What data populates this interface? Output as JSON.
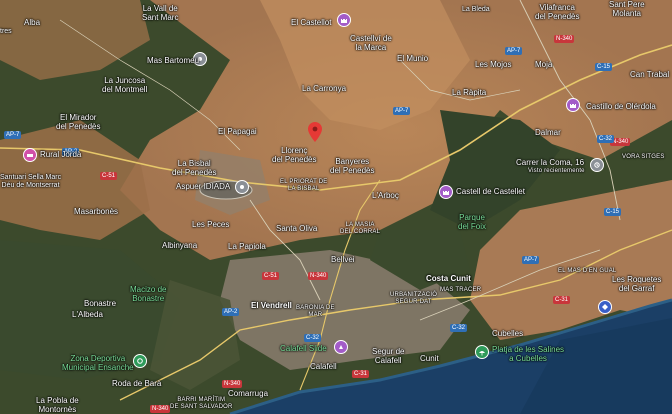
{
  "map": {
    "colors": {
      "water": "#1b3f66",
      "coast": "#2c5f86",
      "terrain": "#b8865a",
      "forest": "#34422a",
      "motorway": "#e7c86a",
      "selected_pin": "#e53935"
    },
    "places": {
      "alba": "Alba",
      "vall_sant_marc": "La Vall de\nSant Marc",
      "el_castellot": "El Castellot",
      "castellvi": "Castellví de\nla Marca",
      "la_bleda": "La Bleda",
      "vilafranca": "Vilafranca\ndel Penedès",
      "sant_pere_molanta": "Sant Pere\nMolanta",
      "mas_bartomeu": "Mas Bartomeu",
      "les_mojos": "Les Mojos",
      "el_munio": "El Munio",
      "moja": "Moja",
      "la_juncosa": "La Juncosa\ndel Montmell",
      "la_carronya": "La Carronya",
      "la_rapita": "La Ràpita",
      "can_trabal": "Can Trabal",
      "tres": "tres",
      "el_mirador": "El Mirador\ndel Penedès",
      "castillo_olerdola": "Castillo de Olérdola",
      "el_papagai": "El Papagai",
      "dalmar": "Dalmar",
      "rural_jorda": "Rural Jordà",
      "santuari": "Santuari Sella Marc\nDéu de Montserrat",
      "bisbal": "La Bisbal\ndel Penedès",
      "llorenc": "Llorenç\ndel Penedès",
      "banyeres": "Banyeres\ndel Penedès",
      "carrer_la_coma": "Carrer la Coma, 16",
      "carrer_sub": "Visto recientemente",
      "vora_sitges": "VORA SITGES",
      "masarbones": "Masarbonès",
      "aspuer_idiada": "Aspuer IDIADA",
      "el_priorat_bisbal": "EL PRIORAT DE\nLA BISBAL",
      "larboc": "L'Arboç",
      "castell_castellet": "Castell de Castellet",
      "parque_foix": "Parque\ndel Foix",
      "les_peces": "Les Peces",
      "santa_oliva": "Santa Oliva",
      "la_papiola": "La Papiola",
      "albinyana": "Albinyana",
      "bellvei": "Bellvei",
      "costa_cunit": "Costa Cunit",
      "mas_tracer": "MAS TRACER",
      "el_mas_d_en_gual": "EL MAS D'EN GUAL",
      "les_roquetes": "Les Roquetes\ndel Garraf",
      "macizo": "Macizo de\nBonastre",
      "bonastre": "Bonastre",
      "la_masia": "LA MASIA\nDEL CORRAL",
      "urb_calafell": "URBANITZACIÓ\nSEGUR DAT",
      "la_albeda": "L'Albeda",
      "el_vendrell": "El Vendrell",
      "baronia_mar": "BARONIA DE\nMAR",
      "cubelles": "Cubelles",
      "zona_deportiva": "Zona Deportiva\nMunicipal Ensanche",
      "calafell_slide": "Calafell Slide",
      "segur_calafell": "Segur de\nCalafell",
      "cunit": "Cunit",
      "platja_salines": "Platja de les Salines\na Cubelles",
      "roda_de_bara": "Roda de Barà",
      "calafell": "Calafell",
      "la_pobla": "La Pobla de\nMontornès",
      "comarruga": "Comarruga",
      "barri_maritim": "BARRI MARÍTIM\nDE SANT SALVADOR"
    },
    "roads": {
      "ap7_nw": "AP-7",
      "c51": "C-51",
      "n340_a": "N-340",
      "ap7_ne": "AP-7",
      "c15_ne": "C-15",
      "n340_b": "N-340",
      "ap7_c": "AP-7",
      "c32_a": "C-32",
      "c15_b": "C-15",
      "ap7_e": "AP-7",
      "c31": "C-31",
      "n340_c": "N-340",
      "c32_b": "C-32",
      "ap2_s": "AP-2",
      "c51_b": "C-51",
      "n340_d": "N-340",
      "c31_b": "C-31",
      "c32_c": "C-32",
      "n340_e": "N-340",
      "ap2_nw": "AP-2"
    }
  }
}
